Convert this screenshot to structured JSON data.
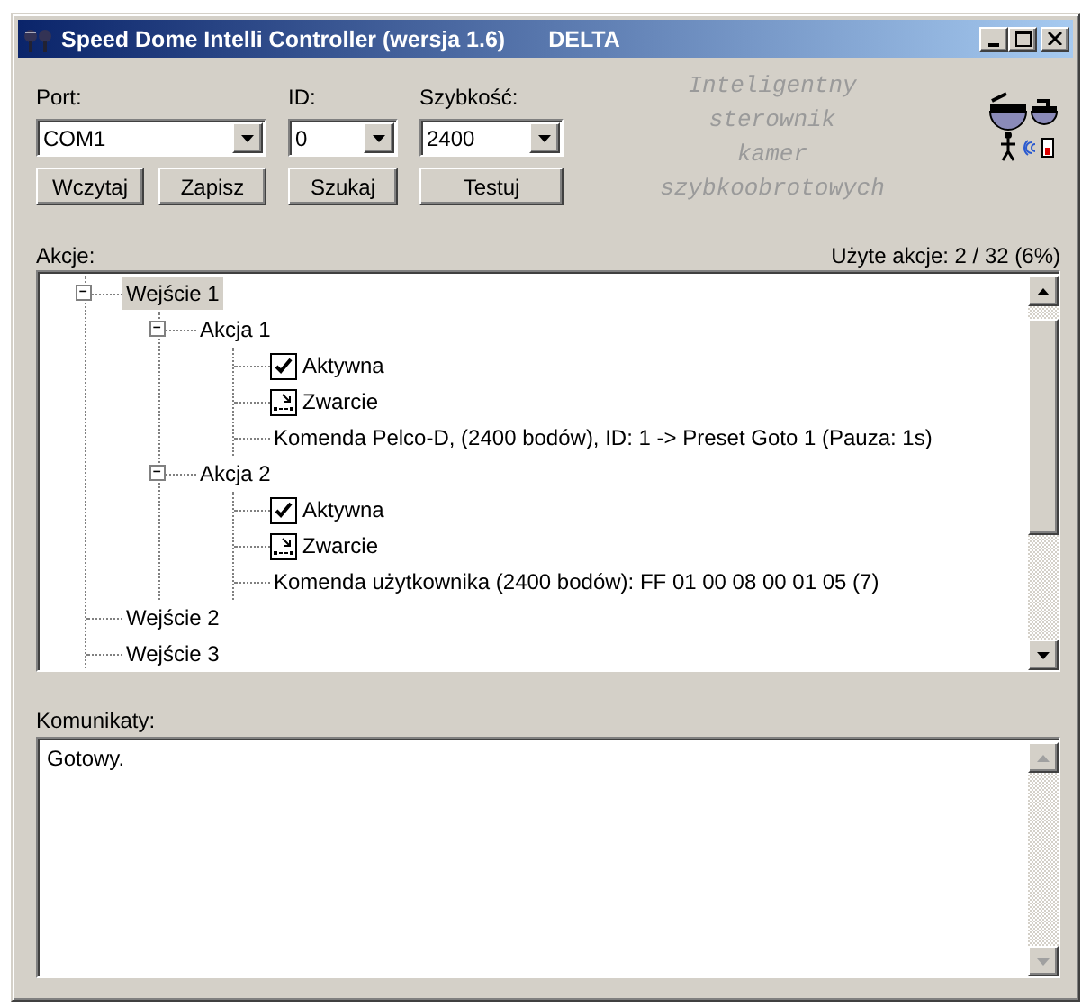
{
  "window": {
    "title": "Speed Dome Intelli Controller (wersja 1.6)",
    "subtitle": "DELTA"
  },
  "settings": [
    {
      "label": "Port:",
      "value": "COM1"
    },
    {
      "label": "ID:",
      "value": "0"
    },
    {
      "label": "Szybkość:",
      "value": "2400"
    }
  ],
  "buttons": [
    "Wczytaj",
    "Zapisz",
    "Szukaj",
    "Testuj"
  ],
  "tagline": [
    "Inteligentny",
    "sterownik",
    "kamer",
    "szybkoobrotowych"
  ],
  "actions": {
    "label": "Akcje:",
    "usage": "Użyte akcje: 2 / 32 (6%)",
    "tree": [
      {
        "label": "Wejście 1",
        "selected": true,
        "expanded": true,
        "children": [
          {
            "label": "Akcja 1",
            "selected": false,
            "expanded": true,
            "children": [
              {
                "kind": "checkbox",
                "label": "Aktywna",
                "selected": false,
                "checked": true
              },
              {
                "kind": "contact",
                "label": "Zwarcie",
                "selected": false
              },
              {
                "kind": "text",
                "label": "Komenda Pelco-D, (2400 bodów), ID: 1 -> Preset Goto 1 (Pauza: 1s)",
                "selected": false
              }
            ]
          },
          {
            "label": "Akcja 2",
            "selected": false,
            "expanded": true,
            "children": [
              {
                "kind": "checkbox",
                "label": "Aktywna",
                "selected": false,
                "checked": true
              },
              {
                "kind": "contact",
                "label": "Zwarcie",
                "selected": false
              },
              {
                "kind": "text",
                "label": "Komenda użytkownika (2400 bodów): FF 01 00 08 00 01 05 (7)",
                "selected": false
              }
            ]
          }
        ]
      },
      {
        "label": "Wejście 2",
        "selected": false
      },
      {
        "label": "Wejście 3",
        "selected": false
      }
    ]
  },
  "messages": {
    "label": "Komunikaty:",
    "lines": [
      "Gotowy."
    ]
  }
}
